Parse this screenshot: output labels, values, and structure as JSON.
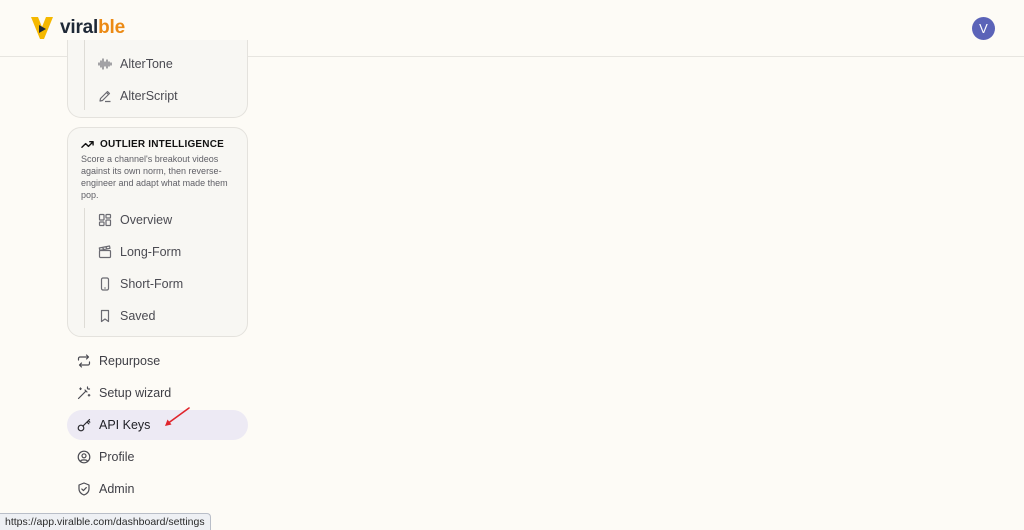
{
  "header": {
    "brand_part1": "viral",
    "brand_part2": "ble",
    "avatar_initial": "V"
  },
  "sidebar": {
    "group_top_items": [
      {
        "label": "AlterTone",
        "icon": "audio-waveform-icon"
      },
      {
        "label": "AlterScript",
        "icon": "pencil-icon"
      }
    ],
    "outlier": {
      "title": "OUTLIER INTELLIGENCE",
      "description": "Score a channel's breakout videos against its own norm, then reverse-engineer and adapt what made them pop.",
      "items": [
        {
          "label": "Overview",
          "icon": "layout-dashboard-icon"
        },
        {
          "label": "Long-Form",
          "icon": "clapperboard-icon"
        },
        {
          "label": "Short-Form",
          "icon": "smartphone-icon"
        },
        {
          "label": "Saved",
          "icon": "bookmark-icon"
        }
      ]
    },
    "nav_items": [
      {
        "label": "Repurpose",
        "icon": "repeat-icon",
        "active": false
      },
      {
        "label": "Setup wizard",
        "icon": "magic-wand-icon",
        "active": false
      },
      {
        "label": "API Keys",
        "icon": "key-icon",
        "active": true
      },
      {
        "label": "Profile",
        "icon": "user-circle-icon",
        "active": false
      },
      {
        "label": "Admin",
        "icon": "shield-check-icon",
        "active": false
      }
    ]
  },
  "status_bar": {
    "url": "https://app.viralble.com/dashboard/settings"
  },
  "colors": {
    "brand_orange": "#ec8a14",
    "logo_yellow": "#f5b800",
    "avatar_bg": "#5b63b8",
    "active_bg": "#edeaf4",
    "annotation_arrow": "#e0242b"
  }
}
